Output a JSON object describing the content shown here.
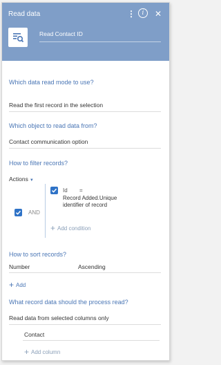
{
  "header": {
    "title": "Read data",
    "element_name": "Read Contact ID",
    "background": "#7f9ec8",
    "icons": [
      "kebab-menu-icon",
      "info-icon",
      "close-icon"
    ]
  },
  "form": {
    "mode_label": "Which data read mode to use?",
    "mode_value": "Read the first record in the selection",
    "object_label": "Which object to read data from?",
    "object_value": "Contact communication option",
    "filter_label": "How to filter records?",
    "actions_label": "Actions",
    "group_operator": "AND",
    "condition": {
      "column": "Id",
      "operator": "=",
      "value": "Record Added.Unique identifier of record"
    },
    "add_condition": "Add condition",
    "sort_label": "How to sort records?",
    "sort_column": "Number",
    "sort_direction": "Ascending",
    "add_sort": "Add",
    "columns_label": "What record data should the process read?",
    "columns_mode": "Read data from selected columns only",
    "columns": [
      "Contact"
    ],
    "add_column": "Add column"
  },
  "colors": {
    "accent": "#4a76b5",
    "checkbox": "#2f73c7"
  }
}
